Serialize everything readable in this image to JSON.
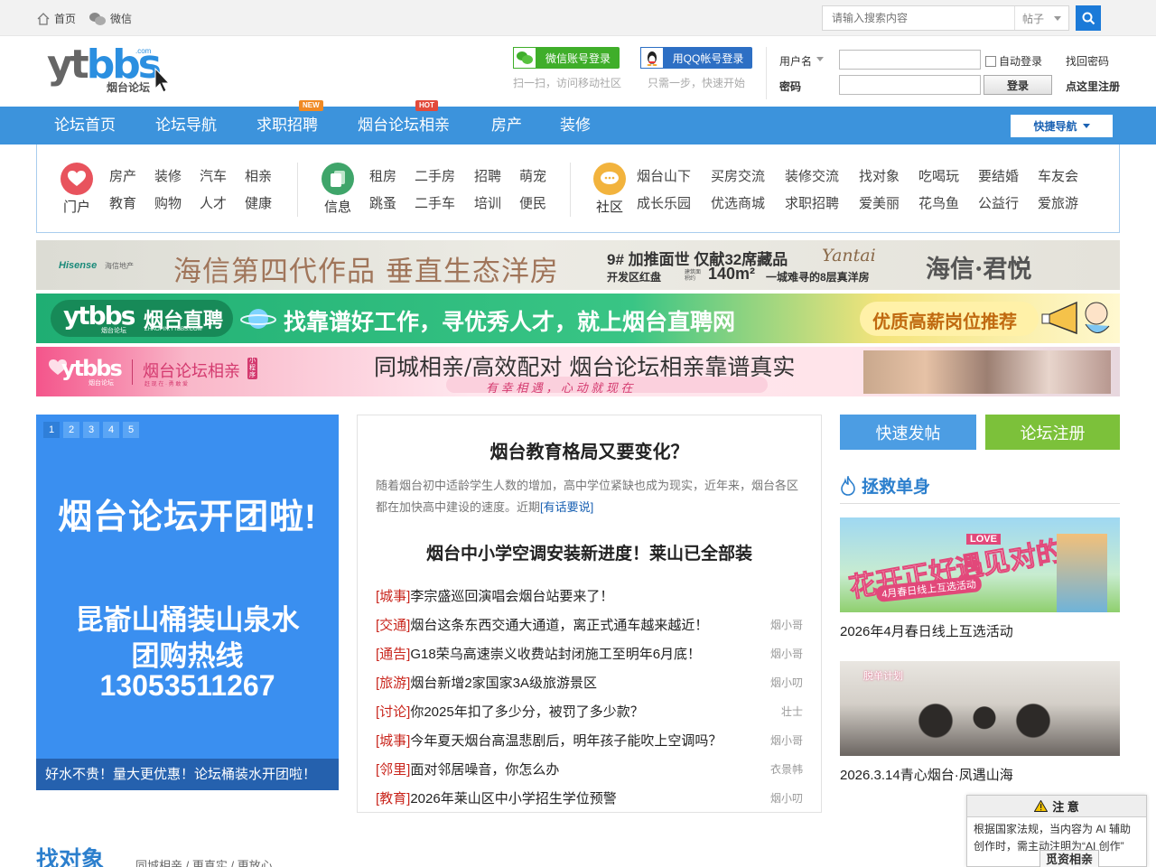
{
  "topbar": {
    "home": "首页",
    "wechat": "微信",
    "search_placeholder": "请输入搜索内容",
    "search_scope": "帖子"
  },
  "logo": {
    "main_gray": "yt",
    "main_blue": "bbs",
    "com": ".com",
    "sub": "烟台论坛"
  },
  "social_login": {
    "wechat_label": "微信账号登录",
    "wechat_hint": "扫一扫，访问移动社区",
    "qq_label": "用QQ帐号登录",
    "qq_hint": "只需一步，快速开始"
  },
  "login": {
    "username_label": "用户名",
    "password_label": "密码",
    "autologin": "自动登录",
    "find_password": "找回密码",
    "login_btn": "登录",
    "register": "点这里注册"
  },
  "nav": {
    "items": [
      "论坛首页",
      "论坛导航",
      "求职招聘",
      "烟台论坛相亲",
      "房产",
      "装修"
    ],
    "badge_new": "NEW",
    "badge_hot": "HOT",
    "quick": "快捷导航"
  },
  "categories": {
    "portal": {
      "name": "门户",
      "links": [
        "房产",
        "装修",
        "汽车",
        "相亲",
        "教育",
        "购物",
        "人才",
        "健康"
      ]
    },
    "info": {
      "name": "信息",
      "links": [
        "租房",
        "二手房",
        "招聘",
        "萌宠",
        "跳蚤",
        "二手车",
        "培训",
        "便民"
      ]
    },
    "community": {
      "name": "社区",
      "links": [
        "烟台山下",
        "买房交流",
        "装修交流",
        "找对象",
        "吃喝玩",
        "要结婚",
        "车友会",
        "成长乐园",
        "优选商城",
        "求职招聘",
        "爱美丽",
        "花鸟鱼",
        "公益行",
        "爱旅游"
      ]
    }
  },
  "banners": {
    "b1": {
      "brand": "Hisense",
      "brand_cn": "海信地产",
      "slogan": "海信第四代作品  垂直生态洋房",
      "line1": "9# 加推面世  仅献32席藏品",
      "sig": "Yantai",
      "line2a": "开发区红盘",
      "line2b": "建筑面积约",
      "area": "140m²",
      "line2c": "一城难寻的8层真洋房",
      "name": "海信·君悦"
    },
    "b2": {
      "logo": "ytbbs",
      "logo_sub": "烟台论坛",
      "title": "烟台直聘",
      "domain": "ZHAOPIN.YTBBS.COM",
      "slogan": "找靠谱好工作，寻优秀人才，就上烟台直聘网",
      "tag": "优质高薪岗位推荐"
    },
    "b3": {
      "logo": "ytbbs",
      "logo_sub": "烟台论坛",
      "title": "烟台论坛相亲",
      "mini": "小程序",
      "motto": "赶 现 在 · 勇 敢 爱",
      "slogan": "同城相亲/高效配对  烟台论坛相亲靠谱真实",
      "sub": "有 幸 相 遇 ， 心 动 就 现 在"
    }
  },
  "slider": {
    "dots": [
      "1",
      "2",
      "3",
      "4",
      "5"
    ],
    "title": "烟台论坛开团啦!",
    "line1": "昆嵛山桶装山泉水",
    "line2": "团购热线",
    "phone": "13053511267",
    "caption": "好水不贵！量大更优惠！论坛桶装水开团啦！"
  },
  "news": {
    "headline1": "烟台教育格局又要变化？",
    "summary": "随着烟台初中适龄学生人数的增加，高中学位紧缺也成为现实，近年来，烟台各区都在加快高中建设的速度。近期",
    "summary_more": "[有话要说]",
    "headline2": "烟台中小学空调安装新进度！莱山已全部装",
    "items": [
      {
        "tag": "[城事]",
        "title": "李宗盛巡回演唱会烟台站要来了！",
        "author": ""
      },
      {
        "tag": "[交通]",
        "title": "烟台这条东西交通大通道，离正式通车越来越近！",
        "author": "烟小哥"
      },
      {
        "tag": "[通告]",
        "title": "G18荣乌高速崇义收费站封闭施工至明年6月底！",
        "author": "烟小哥"
      },
      {
        "tag": "[旅游]",
        "title": "烟台新增2家国家3A级旅游景区",
        "author": "烟小叨"
      },
      {
        "tag": "[讨论]",
        "title": "你2025年扣了多少分，被罚了多少款？",
        "author": "壮士"
      },
      {
        "tag": "[城事]",
        "title": "今年夏天烟台高温悲剧后，明年孩子能吹上空调吗？",
        "author": "烟小哥"
      },
      {
        "tag": "[邻里]",
        "title": "面对邻居噪音，你怎么办",
        "author": "衣景帏"
      },
      {
        "tag": "[教育]",
        "title": "2026年莱山区中小学招生学位预警",
        "author": "烟小叨"
      }
    ]
  },
  "right": {
    "post_btn": "快速发帖",
    "register_btn": "论坛注册",
    "section_title": "拯救单身",
    "thumb1_banner": "花开正好遇见对的人",
    "thumb1_love": "LOVE",
    "thumb1_sub": "4月春日线上互选活动",
    "thumb1_caption": "2026年4月春日线上互选活动",
    "thumb2_logo": "脱单计划",
    "thumb2_caption": "2026.3.14青心烟台·凤遇山海"
  },
  "bottom": {
    "title": "找对象",
    "subtitle": "同城相亲 / 更真实 / 更放心"
  },
  "notice": {
    "title": "注 意",
    "body": "根据国家法规，当内容为 AI 辅助创作时，需主动注明为“AI 创作”",
    "footer": "觅资相亲"
  },
  "colors": {
    "nav": "#3c93dc",
    "accent": "#2c7fcd",
    "tag_red": "#c9251c",
    "green": "#7cc13a"
  }
}
